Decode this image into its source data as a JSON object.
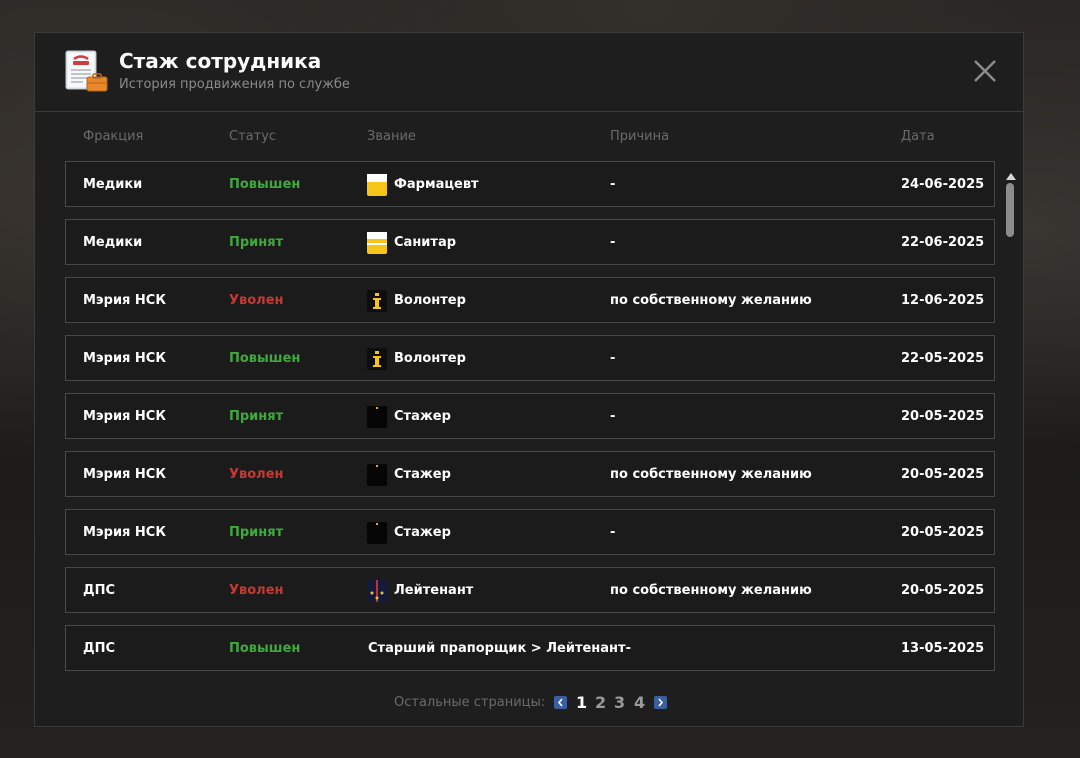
{
  "window": {
    "title": "Стаж сотрудника",
    "subtitle": "История продвижения по службе"
  },
  "columns": {
    "faction": "Фракция",
    "status": "Статус",
    "rank": "Звание",
    "reason": "Причина",
    "date": "Дата"
  },
  "rows": [
    {
      "faction": "Медики",
      "status": "Повышен",
      "status_type": "green",
      "rank": "Фармацевт",
      "rank_icon": "yellow-badge-icon",
      "reason": "-",
      "date": "24-06-2025"
    },
    {
      "faction": "Медики",
      "status": "Принят",
      "status_type": "green",
      "rank": "Санитар",
      "rank_icon": "yellow-stripe-badge-icon",
      "reason": "-",
      "date": "22-06-2025"
    },
    {
      "faction": "Мэрия НСК",
      "status": "Уволен",
      "status_type": "red",
      "rank": "Волонтер",
      "rank_icon": "info-badge-icon",
      "reason": "по собственному желанию",
      "date": "12-06-2025"
    },
    {
      "faction": "Мэрия НСК",
      "status": "Повышен",
      "status_type": "green",
      "rank": "Волонтер",
      "rank_icon": "info-badge-icon",
      "reason": "-",
      "date": "22-05-2025"
    },
    {
      "faction": "Мэрия НСК",
      "status": "Принят",
      "status_type": "green",
      "rank": "Стажер",
      "rank_icon": "black-badge-icon",
      "reason": "-",
      "date": "20-05-2025"
    },
    {
      "faction": "Мэрия НСК",
      "status": "Уволен",
      "status_type": "red",
      "rank": "Стажер",
      "rank_icon": "black-badge-icon",
      "reason": "по собственному желанию",
      "date": "20-05-2025"
    },
    {
      "faction": "Мэрия НСК",
      "status": "Принят",
      "status_type": "green",
      "rank": "Стажер",
      "rank_icon": "black-badge-icon",
      "reason": "-",
      "date": "20-05-2025"
    },
    {
      "faction": "ДПС",
      "status": "Уволен",
      "status_type": "red",
      "rank": "Лейтенант",
      "rank_icon": "shoulder-strap-icon",
      "reason": "по собственному желанию",
      "date": "20-05-2025"
    },
    {
      "faction": "ДПС",
      "status": "Повышен",
      "status_type": "green",
      "rank": "Старший прапорщик > Лейтенант",
      "rank_icon": "",
      "reason": "-",
      "date": "13-05-2025"
    }
  ],
  "pager": {
    "label": "Остальные страницы:",
    "pages": [
      "1",
      "2",
      "3",
      "4"
    ],
    "current": "1"
  },
  "colors": {
    "green": "#3fa93d",
    "red": "#c13b34",
    "accent": "#3a5f9c"
  }
}
